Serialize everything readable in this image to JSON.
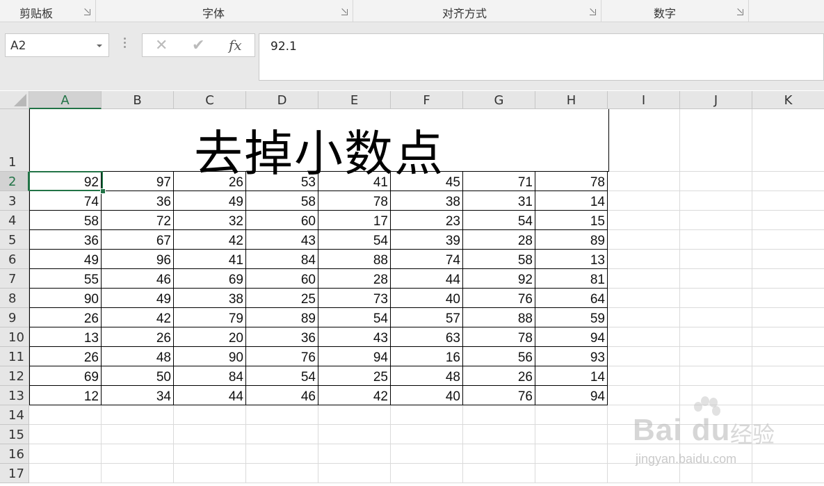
{
  "ribbon": {
    "groups": [
      {
        "label": "剪贴板"
      },
      {
        "label": "字体"
      },
      {
        "label": "对齐方式"
      },
      {
        "label": "数字"
      }
    ]
  },
  "formula_bar": {
    "name_box": "A2",
    "cancel_icon": "✕",
    "enter_icon": "✔",
    "fx_label": "fx",
    "value": "92.1"
  },
  "sheet": {
    "selected_cell": "A2",
    "columns": [
      "A",
      "B",
      "C",
      "D",
      "E",
      "F",
      "G",
      "H",
      "I",
      "J",
      "K"
    ],
    "rows": [
      "1",
      "2",
      "3",
      "4",
      "5",
      "6",
      "7",
      "8",
      "9",
      "10",
      "11",
      "12",
      "13",
      "14",
      "15",
      "16",
      "17"
    ],
    "title": "去掉小数点",
    "data": [
      [
        "92",
        "97",
        "26",
        "53",
        "41",
        "45",
        "71",
        "78"
      ],
      [
        "74",
        "36",
        "49",
        "58",
        "78",
        "38",
        "31",
        "14"
      ],
      [
        "58",
        "72",
        "32",
        "60",
        "17",
        "23",
        "54",
        "15"
      ],
      [
        "36",
        "67",
        "42",
        "43",
        "54",
        "39",
        "28",
        "89"
      ],
      [
        "49",
        "96",
        "41",
        "84",
        "88",
        "74",
        "58",
        "13"
      ],
      [
        "55",
        "46",
        "69",
        "60",
        "28",
        "44",
        "92",
        "81"
      ],
      [
        "90",
        "49",
        "38",
        "25",
        "73",
        "40",
        "76",
        "64"
      ],
      [
        "26",
        "42",
        "79",
        "89",
        "54",
        "57",
        "88",
        "59"
      ],
      [
        "13",
        "26",
        "20",
        "36",
        "43",
        "63",
        "78",
        "94"
      ],
      [
        "26",
        "48",
        "90",
        "76",
        "94",
        "16",
        "56",
        "93"
      ],
      [
        "69",
        "50",
        "84",
        "54",
        "25",
        "48",
        "26",
        "14"
      ],
      [
        "12",
        "34",
        "44",
        "46",
        "42",
        "40",
        "76",
        "94"
      ]
    ]
  },
  "watermark": {
    "logo": "Bai du",
    "text": "经验",
    "url": "jingyan.baidu.com"
  },
  "colors": {
    "accent": "#217346",
    "grid": "#dadada",
    "header_bg": "#e6e6e6"
  }
}
